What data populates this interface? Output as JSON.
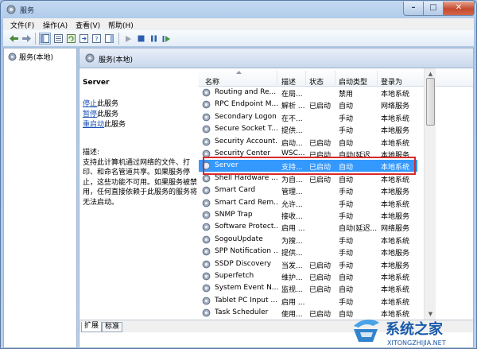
{
  "window": {
    "title": "服务",
    "controls": {
      "min": "–",
      "max": "□",
      "close": "✕"
    }
  },
  "menu": [
    {
      "label": "文件(F)"
    },
    {
      "label": "操作(A)"
    },
    {
      "label": "查看(V)"
    },
    {
      "label": "帮助(H)"
    }
  ],
  "tree": {
    "root_label": "服务(本地)"
  },
  "pane_header": {
    "title": "服务(本地)"
  },
  "detail": {
    "service_name": "Server",
    "actions": [
      {
        "link": "停止",
        "rest": "此服务"
      },
      {
        "link": "暂停",
        "rest": "此服务"
      },
      {
        "link": "重启动",
        "rest": "此服务"
      }
    ],
    "description_label": "描述:",
    "description": "支持此计算机通过网络的文件、打印、和命名管道共享。如果服务停止，这些功能不可用。如果服务被禁用，任何直接依赖于此服务的服务将无法启动。"
  },
  "columns": [
    {
      "label": "名称"
    },
    {
      "label": "描述"
    },
    {
      "label": "状态"
    },
    {
      "label": "启动类型"
    },
    {
      "label": "登录为"
    }
  ],
  "rows": [
    {
      "name": "Routing and Re...",
      "desc": "在局...",
      "status": "",
      "startup": "禁用",
      "logon": "本地系统"
    },
    {
      "name": "RPC Endpoint M...",
      "desc": "解析 ...",
      "status": "已启动",
      "startup": "自动",
      "logon": "网络服务"
    },
    {
      "name": "Secondary Logon",
      "desc": "在不...",
      "status": "",
      "startup": "手动",
      "logon": "本地系统"
    },
    {
      "name": "Secure Socket T...",
      "desc": "提供...",
      "status": "",
      "startup": "手动",
      "logon": "本地服务"
    },
    {
      "name": "Security Account...",
      "desc": "启动...",
      "status": "已启动",
      "startup": "自动",
      "logon": "本地系统"
    },
    {
      "name": "Security Center",
      "desc": "WSC...",
      "status": "已启动",
      "startup": "自动(延迟...",
      "logon": "本地服务"
    },
    {
      "name": "Server",
      "desc": "支持...",
      "status": "已启动",
      "startup": "自动",
      "logon": "本地系统",
      "selected": true
    },
    {
      "name": "Shell Hardware ...",
      "desc": "为自...",
      "status": "已启动",
      "startup": "自动",
      "logon": "本地系统"
    },
    {
      "name": "Smart Card",
      "desc": "管理...",
      "status": "",
      "startup": "手动",
      "logon": "本地服务"
    },
    {
      "name": "Smart Card Rem...",
      "desc": "允许...",
      "status": "",
      "startup": "手动",
      "logon": "本地系统"
    },
    {
      "name": "SNMP Trap",
      "desc": "接收...",
      "status": "",
      "startup": "手动",
      "logon": "本地服务"
    },
    {
      "name": "Software Protect...",
      "desc": "启用 ...",
      "status": "",
      "startup": "自动(延迟...",
      "logon": "网络服务"
    },
    {
      "name": "SogouUpdate",
      "desc": "为搜...",
      "status": "",
      "startup": "手动",
      "logon": "本地系统"
    },
    {
      "name": "SPP Notification ...",
      "desc": "提供...",
      "status": "",
      "startup": "手动",
      "logon": "本地服务"
    },
    {
      "name": "SSDP Discovery",
      "desc": "当发...",
      "status": "已启动",
      "startup": "手动",
      "logon": "本地服务"
    },
    {
      "name": "Superfetch",
      "desc": "维护...",
      "status": "已启动",
      "startup": "自动",
      "logon": "本地系统"
    },
    {
      "name": "System Event N...",
      "desc": "监视...",
      "status": "已启动",
      "startup": "自动",
      "logon": "本地系统"
    },
    {
      "name": "Tablet PC Input ...",
      "desc": "启用 ...",
      "status": "",
      "startup": "手动",
      "logon": "本地系统"
    },
    {
      "name": "Task Scheduler",
      "desc": "使用...",
      "status": "已启动",
      "startup": "自动",
      "logon": "本地系统"
    }
  ],
  "tabs": [
    {
      "label": "扩展"
    },
    {
      "label": "标准"
    }
  ],
  "watermark": {
    "name": "系统之家",
    "url": "XITONGZHIJIA.NET"
  },
  "colors": {
    "selection": "#3399ff",
    "highlight_box": "#d9292b",
    "link": "#1a4fb5"
  }
}
